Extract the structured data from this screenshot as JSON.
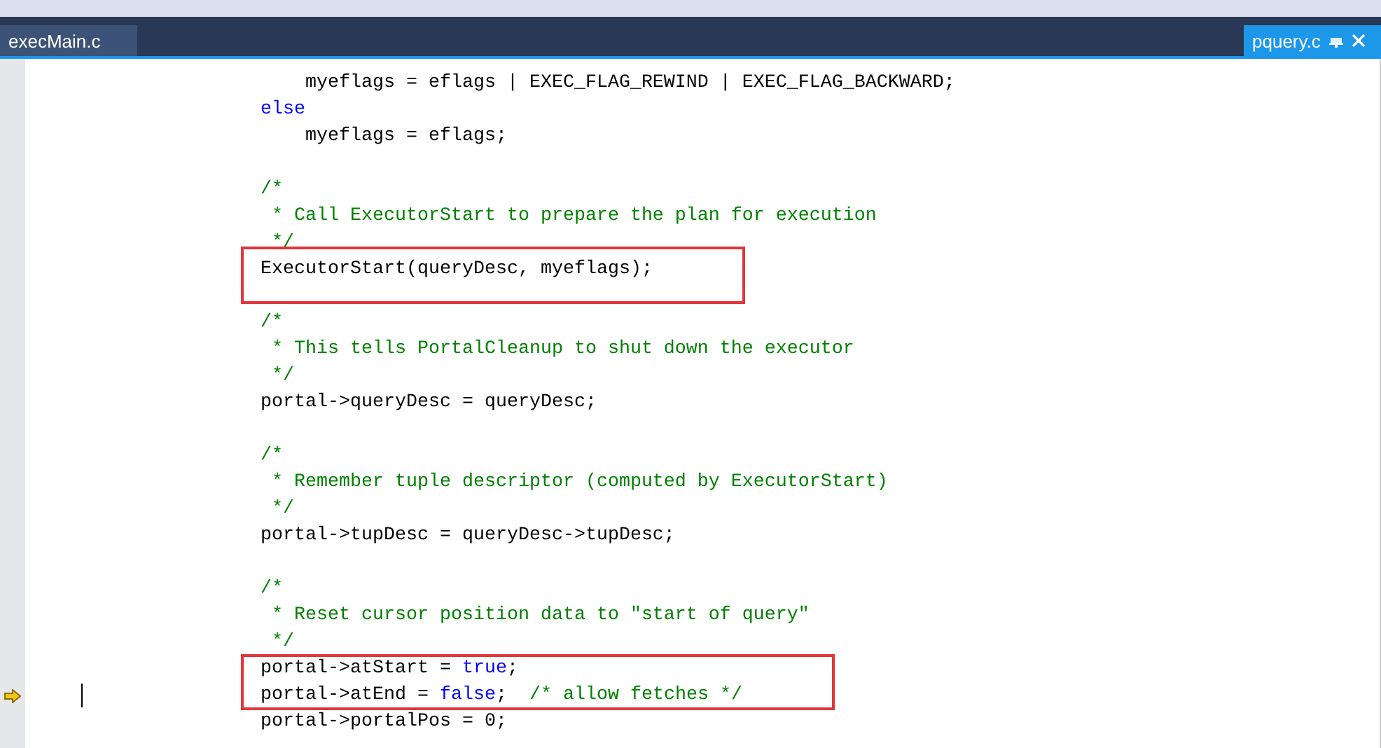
{
  "tabs": [
    {
      "label": "execMain.c",
      "selected": false
    },
    {
      "label": "pquery.c",
      "selected": true
    }
  ],
  "editor": {
    "lines": [
      {
        "kind": "text",
        "tokens": [
          {
            "kind": "code",
            "text": "    myeflags = eflags | EXEC_FLAG_REWIND | EXEC_FLAG_BACKWARD;"
          }
        ]
      },
      {
        "kind": "text",
        "tokens": [
          {
            "kind": "keyword",
            "text": "else"
          }
        ]
      },
      {
        "kind": "text",
        "tokens": [
          {
            "kind": "code",
            "text": "    myeflags = eflags;"
          }
        ]
      },
      {
        "kind": "blank"
      },
      {
        "kind": "text",
        "tokens": [
          {
            "kind": "comment",
            "text": "/*"
          }
        ]
      },
      {
        "kind": "text",
        "tokens": [
          {
            "kind": "comment",
            "text": " * Call ExecutorStart to prepare the plan for execution"
          }
        ]
      },
      {
        "kind": "text",
        "tokens": [
          {
            "kind": "comment",
            "text": " */"
          }
        ]
      },
      {
        "kind": "text",
        "boxed": true,
        "tokens": [
          {
            "kind": "code",
            "text": "ExecutorStart(queryDesc, myeflags);"
          }
        ]
      },
      {
        "kind": "blank"
      },
      {
        "kind": "text",
        "tokens": [
          {
            "kind": "comment",
            "text": "/*"
          }
        ]
      },
      {
        "kind": "text",
        "tokens": [
          {
            "kind": "comment",
            "text": " * This tells PortalCleanup to shut down the executor"
          }
        ]
      },
      {
        "kind": "text",
        "tokens": [
          {
            "kind": "comment",
            "text": " */"
          }
        ]
      },
      {
        "kind": "text",
        "tokens": [
          {
            "kind": "code",
            "text": "portal->queryDesc = queryDesc;"
          }
        ]
      },
      {
        "kind": "blank"
      },
      {
        "kind": "text",
        "tokens": [
          {
            "kind": "comment",
            "text": "/*"
          }
        ]
      },
      {
        "kind": "text",
        "tokens": [
          {
            "kind": "comment",
            "text": " * Remember tuple descriptor (computed by ExecutorStart)"
          }
        ]
      },
      {
        "kind": "text",
        "tokens": [
          {
            "kind": "comment",
            "text": " */"
          }
        ]
      },
      {
        "kind": "text",
        "tokens": [
          {
            "kind": "code",
            "text": "portal->tupDesc = queryDesc->tupDesc;"
          }
        ]
      },
      {
        "kind": "blank"
      },
      {
        "kind": "text",
        "tokens": [
          {
            "kind": "comment",
            "text": "/*"
          }
        ]
      },
      {
        "kind": "text",
        "tokens": [
          {
            "kind": "comment",
            "text": " * Reset cursor position data to \"start of query\""
          }
        ]
      },
      {
        "kind": "text",
        "tokens": [
          {
            "kind": "comment",
            "text": " */"
          }
        ]
      },
      {
        "kind": "text",
        "boxed": true,
        "tokens": [
          {
            "kind": "code",
            "text": "portal->atStart = "
          },
          {
            "kind": "keyword",
            "text": "true"
          },
          {
            "kind": "code",
            "text": ";"
          }
        ]
      },
      {
        "kind": "text",
        "boxed": true,
        "current": true,
        "caret": true,
        "tokens": [
          {
            "kind": "code",
            "text": "portal->atEnd = "
          },
          {
            "kind": "keyword",
            "text": "false"
          },
          {
            "kind": "code",
            "text": ";  "
          },
          {
            "kind": "comment",
            "text": "/* allow fetches */"
          }
        ]
      },
      {
        "kind": "text",
        "tokens": [
          {
            "kind": "code",
            "text": "portal->portalPos = 0;"
          }
        ]
      }
    ]
  }
}
